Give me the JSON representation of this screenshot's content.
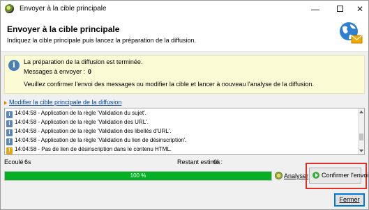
{
  "window": {
    "title": "Envoyer à la cible principale",
    "controls": {
      "minimize": "—",
      "close": "✕"
    }
  },
  "header": {
    "title": "Envoyer à la cible principale",
    "subtitle": "Indiquez la cible principale puis lancez la préparation de la diffusion."
  },
  "info": {
    "line1": "La préparation de la diffusion est terminée.",
    "messages_label": "Messages à envoyer :",
    "messages_count": "0",
    "line3": "Veuillez confirmer l'envoi des messages ou modifier la cible et lancer à nouveau l'analyse de la diffusion."
  },
  "modify_link": "Modifier la cible principale de la diffusion",
  "log": [
    {
      "icon": "info-icon",
      "text": "14:04:58 - Application de la règle 'Validation du sujet'."
    },
    {
      "icon": "info-icon",
      "text": "14:04:58 - Application de la règle 'Validation des URL'."
    },
    {
      "icon": "info-icon",
      "text": "14:04:58 - Application de la règle 'Validation des libellés d'URL'."
    },
    {
      "icon": "info-icon",
      "text": "14:04:58 - Application de la règle 'Validation du lien de désinscription'."
    },
    {
      "icon": "warning-icon",
      "text": "14:04:58 - Pas de lien de désinscription dans le contenu HTML."
    }
  ],
  "progress": {
    "elapsed_label": "Ecoulé :",
    "elapsed_value": "6s",
    "remaining_label": "Restant estimé :",
    "remaining_value": "0s",
    "percent_text": "100 %",
    "fraction": 1.0
  },
  "buttons": {
    "analyse": "Analyser",
    "confirm": "Confirmer l'envoi",
    "close": "Fermer"
  },
  "colors": {
    "progress": "#06b025",
    "highlight": "#e0302b",
    "info_bg": "#fbfbd6"
  }
}
